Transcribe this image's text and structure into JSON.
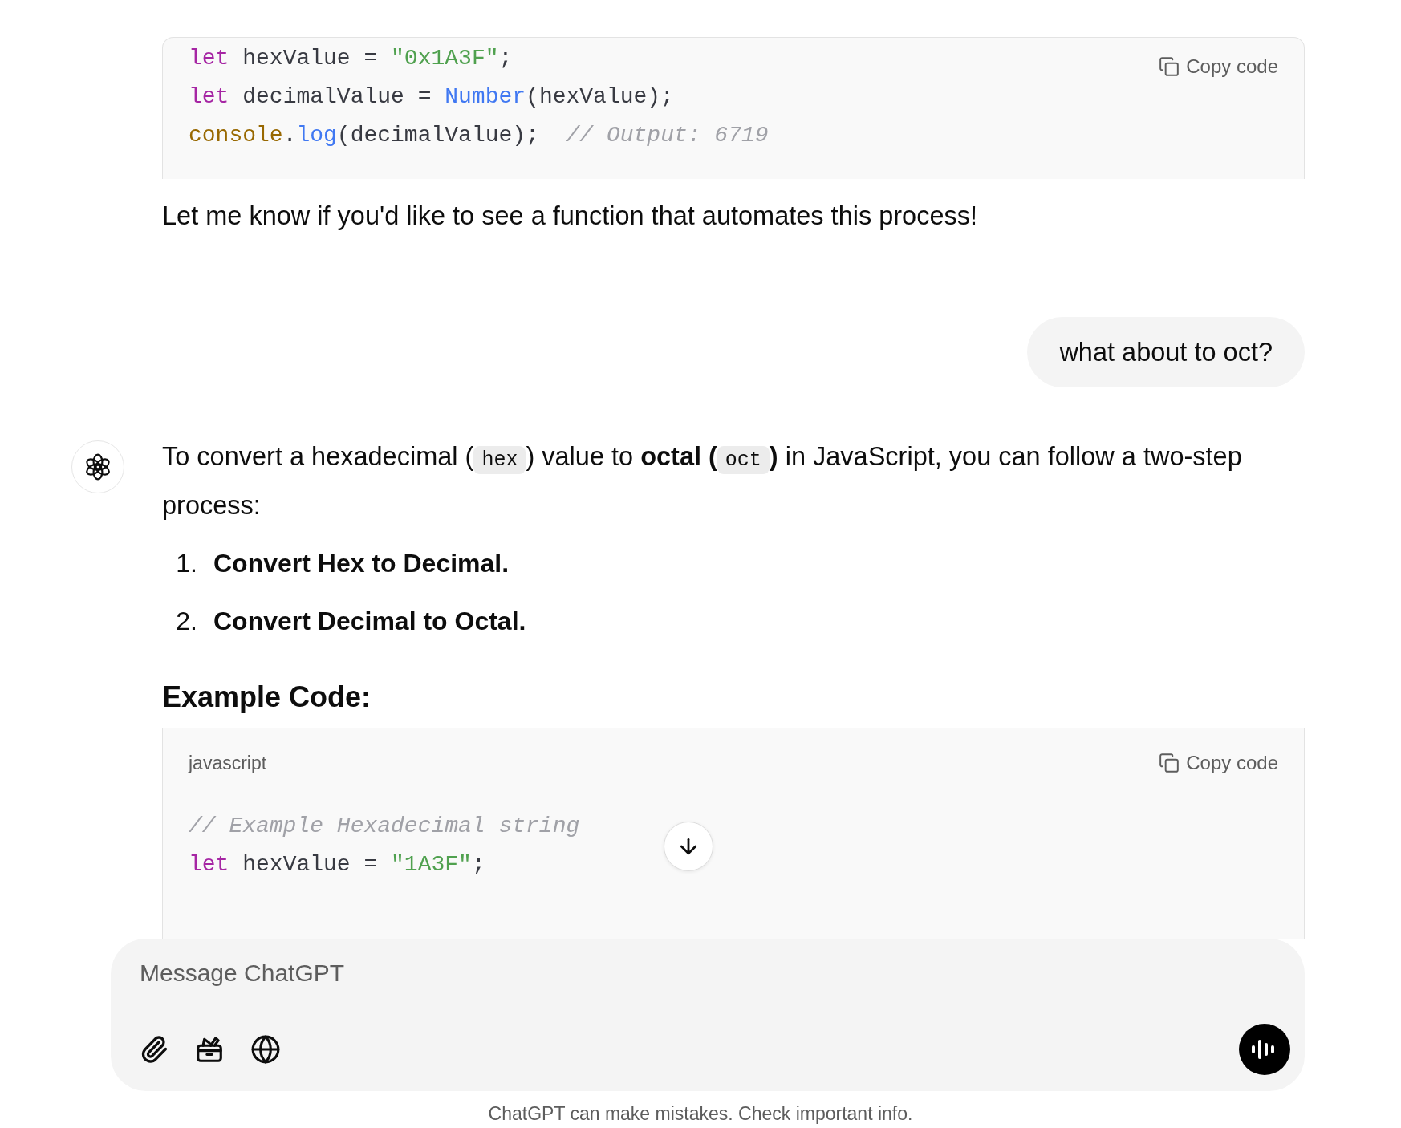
{
  "earlier_code": {
    "copy_label": "Copy code",
    "lines": [
      [
        {
          "kind": "keyword",
          "text": "let"
        },
        {
          "kind": "plain",
          "text": " hexValue = "
        },
        {
          "kind": "string",
          "text": "\"0x1A3F\""
        },
        {
          "kind": "plain",
          "text": ";"
        }
      ],
      [
        {
          "kind": "keyword",
          "text": "let"
        },
        {
          "kind": "plain",
          "text": " decimalValue = "
        },
        {
          "kind": "builtin",
          "text": "Number"
        },
        {
          "kind": "plain",
          "text": "(hexValue);"
        }
      ],
      [
        {
          "kind": "object",
          "text": "console"
        },
        {
          "kind": "plain",
          "text": "."
        },
        {
          "kind": "builtin",
          "text": "log"
        },
        {
          "kind": "plain",
          "text": "(decimalValue);  "
        },
        {
          "kind": "comment",
          "text": "// Output: 6719"
        }
      ]
    ]
  },
  "closing_text": "Let me know if you'd like to see a function that automates this process!",
  "user_message": "what about to oct?",
  "assistant": {
    "intro": [
      {
        "kind": "text",
        "text": "To convert a hexadecimal ("
      },
      {
        "kind": "code",
        "text": "hex"
      },
      {
        "kind": "text",
        "text": ") value to "
      },
      {
        "kind": "bold",
        "text": "octal ("
      },
      {
        "kind": "code",
        "text": "oct"
      },
      {
        "kind": "bold",
        "text": ")"
      },
      {
        "kind": "text",
        "text": " in JavaScript, you can follow a two-step process:"
      }
    ],
    "steps": [
      {
        "number": "1.",
        "text": "Convert Hex to Decimal."
      },
      {
        "number": "2.",
        "text": "Convert Decimal to Octal."
      }
    ],
    "heading": "Example Code:",
    "code": {
      "language": "javascript",
      "copy_label": "Copy code",
      "lines": [
        [
          {
            "kind": "comment",
            "text": "// Example Hexadecimal string"
          }
        ],
        [
          {
            "kind": "keyword",
            "text": "let"
          },
          {
            "kind": "plain",
            "text": " hexValue = "
          },
          {
            "kind": "string",
            "text": "\"1A3F\""
          },
          {
            "kind": "plain",
            "text": ";"
          }
        ]
      ]
    }
  },
  "composer": {
    "placeholder": "Message ChatGPT"
  },
  "footer": "ChatGPT can make mistakes. Check important info."
}
